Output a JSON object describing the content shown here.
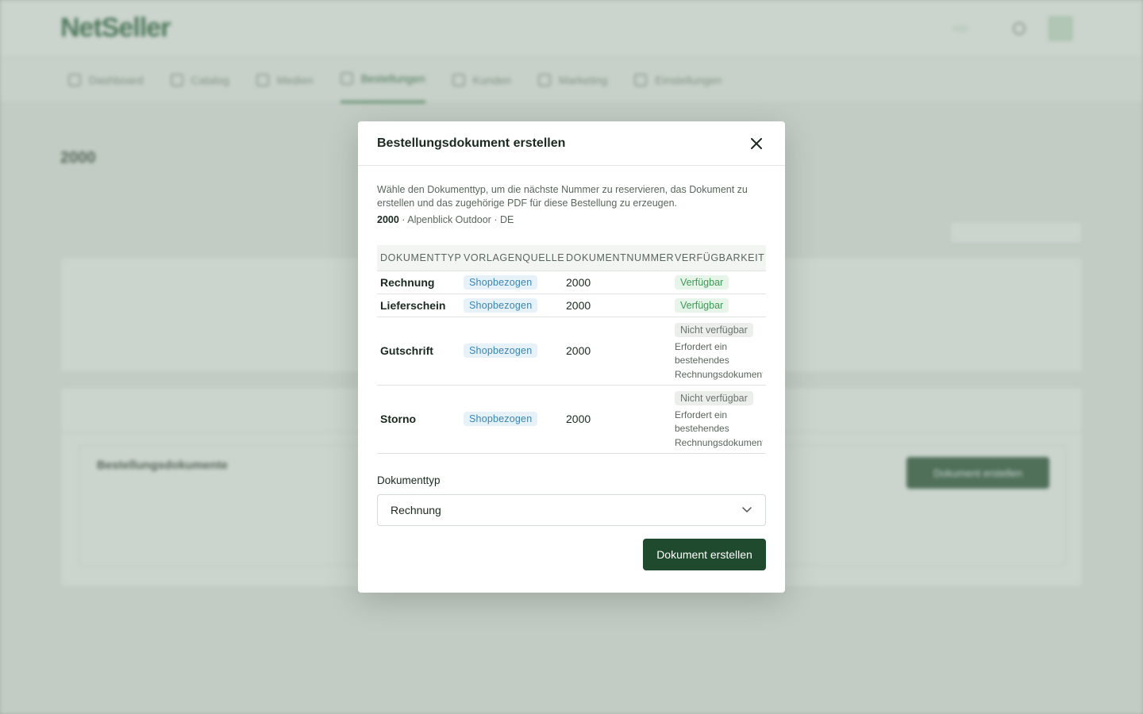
{
  "background": {
    "logo": "NetSeller",
    "nav_items": [
      {
        "label": "Dashboard"
      },
      {
        "label": "Catalog"
      },
      {
        "label": "Medien"
      },
      {
        "label": "Bestellungen"
      },
      {
        "label": "Kunden"
      },
      {
        "label": "Marketing"
      },
      {
        "label": "Einstellungen"
      }
    ],
    "page_title": "2000",
    "card_section_title": "Bestellungsdokumente",
    "create_button": "Dokument erstellen"
  },
  "modal": {
    "title": "Bestellungsdokument erstellen",
    "description": "Wähle den Dokumenttyp, um die nächste Nummer zu reservieren, das Dokument zu erstellen und das zugehörige PDF für diese Bestellung zu erzeugen.",
    "meta_number": "2000",
    "meta_rest": " · Alpenblick Outdoor · DE",
    "columns": [
      "DOKUMENTTYP",
      "VORLAGENQUELLE",
      "DOKUMENTNUMMER",
      "VERFÜGBARKEIT"
    ],
    "rows": [
      {
        "type": "Rechnung",
        "source": "Shopbezogen",
        "number": "2000",
        "availability": "Verfügbar",
        "note": ""
      },
      {
        "type": "Lieferschein",
        "source": "Shopbezogen",
        "number": "2000",
        "availability": "Verfügbar",
        "note": ""
      },
      {
        "type": "Gutschrift",
        "source": "Shopbezogen",
        "number": "2000",
        "availability": "Nicht verfügbar",
        "note": [
          "Erfordert ein",
          "bestehendes",
          "Rechnungsdokument"
        ]
      },
      {
        "type": "Storno",
        "source": "Shopbezogen",
        "number": "2000",
        "availability": "Nicht verfügbar",
        "note": [
          "Erfordert ein",
          "bestehendes",
          "Rechnungsdokument"
        ]
      }
    ],
    "field_label": "Dokumenttyp",
    "select_value": "Rechnung",
    "submit_label": "Dokument erstellen"
  },
  "colors": {
    "primary": "#1f4a2e",
    "available": "#3d9a54",
    "source_badge": "#3a86b3"
  }
}
